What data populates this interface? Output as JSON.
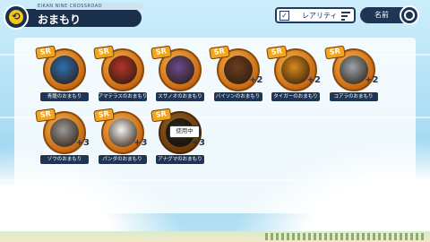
{
  "header": {
    "subtitle": "EIKAN NINE CROSSROAD",
    "title": "おまもり",
    "back_icon": "back-arrow-icon"
  },
  "toolbar": {
    "sort_label": "レアリティ",
    "name_label": "名前",
    "checkbox_icon": "checkmark-icon",
    "sort_icon": "sort-lines-icon",
    "refresh_icon": "refresh-icon"
  },
  "colors": {
    "navy": "#1f3556",
    "medal_orange": "#e08a22",
    "sr_badge": "#f2a51e",
    "sky": "#bfe3f6"
  },
  "charms": [
    {
      "label": "青龍のおまもり",
      "rarity": "SR",
      "plus": "",
      "icon": "dragon-icon",
      "color": "#2c6fb5",
      "used": false
    },
    {
      "label": "アマテラスのおまもり",
      "rarity": "SR",
      "plus": "",
      "icon": "amaterasu-icon",
      "color": "#b3342c",
      "used": false
    },
    {
      "label": "スサノオのおまもり",
      "rarity": "SR",
      "plus": "",
      "icon": "susanoo-icon",
      "color": "#6b4a8f",
      "used": false
    },
    {
      "label": "バイソンのおまもり",
      "rarity": "SR",
      "plus": "+2",
      "icon": "bison-icon",
      "color": "#6b3e22",
      "used": false
    },
    {
      "label": "タイガーのおまもり",
      "rarity": "SR",
      "plus": "+2",
      "icon": "tiger-icon",
      "color": "#d88a1c",
      "used": false
    },
    {
      "label": "コアラのおまもり",
      "rarity": "SR",
      "plus": "+2",
      "icon": "koala-icon",
      "color": "#9aa3ab",
      "used": false
    },
    {
      "label": "ゾウのおまもり",
      "rarity": "SR",
      "plus": "+3",
      "icon": "elephant-icon",
      "color": "#9a9a9a",
      "used": false
    },
    {
      "label": "パンダのおまもり",
      "rarity": "SR",
      "plus": "+3",
      "icon": "panda-icon",
      "color": "#f2f2f2",
      "used": false
    },
    {
      "label": "アナグマのおまもり",
      "rarity": "SR",
      "plus": "+3",
      "icon": "badger-icon",
      "color": "#4a4a3a",
      "used": true,
      "used_label": "使用中"
    }
  ]
}
